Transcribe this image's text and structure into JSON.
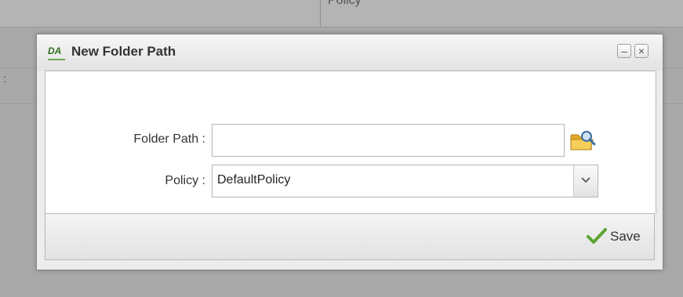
{
  "background": {
    "column_header": "Policy",
    "left_mark": ":"
  },
  "dialog": {
    "logo_text": "DA",
    "title": "New Folder Path",
    "minimize_symbol": "–",
    "close_symbol": "×",
    "fields": {
      "folder_path_label": "Folder Path :",
      "folder_path_value": "",
      "policy_label": "Policy :",
      "policy_value": "DefaultPolicy"
    },
    "footer": {
      "save_label": "Save"
    }
  },
  "colors": {
    "accent_green": "#5ea531",
    "folder_yellow": "#f2c34b"
  },
  "icons": [
    "folder-browse-icon",
    "chevron-down-icon",
    "checkmark-icon",
    "minimize-icon",
    "close-icon"
  ]
}
